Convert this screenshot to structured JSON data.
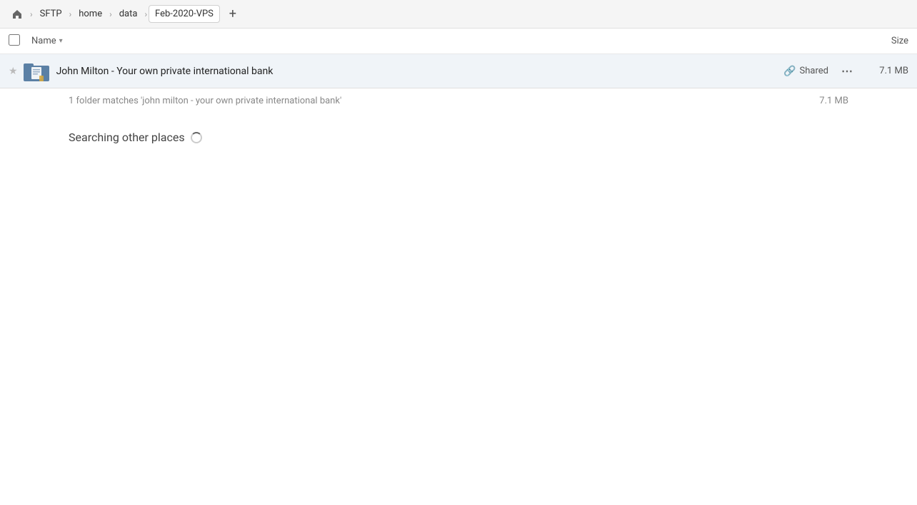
{
  "breadcrumbs": {
    "home_icon": "⌂",
    "items": [
      {
        "label": "SFTP",
        "active": false
      },
      {
        "label": "home",
        "active": false
      },
      {
        "label": "data",
        "active": false
      },
      {
        "label": "Feb-2020-VPS",
        "active": true
      }
    ],
    "add_tab_icon": "+"
  },
  "columns": {
    "name_label": "Name",
    "size_label": "Size"
  },
  "file_row": {
    "star_icon": "★",
    "name": "John Milton - Your own private international bank",
    "shared_label": "Shared",
    "more_icon": "⋯",
    "size": "7.1 MB"
  },
  "search": {
    "results_text": "1 folder matches 'john milton - your own private international bank'",
    "results_size": "7.1 MB",
    "searching_other_label": "Searching other places"
  }
}
